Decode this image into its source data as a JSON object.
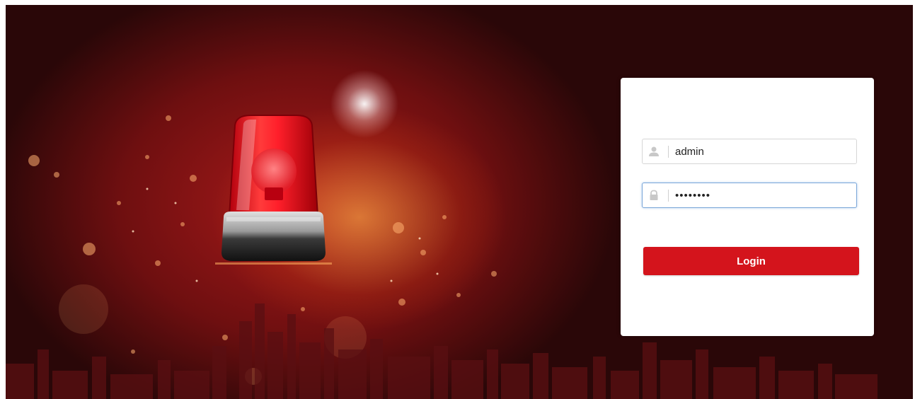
{
  "login": {
    "username_value": "admin",
    "password_value": "••••••••",
    "login_label": "Login"
  },
  "icons": {
    "user_field": "user-icon",
    "password_field": "lock-icon",
    "hero": "siren-icon"
  },
  "colors": {
    "accent": "#d4141c",
    "focus_border": "#7aa6d8",
    "background_dark": "#2a0708"
  }
}
